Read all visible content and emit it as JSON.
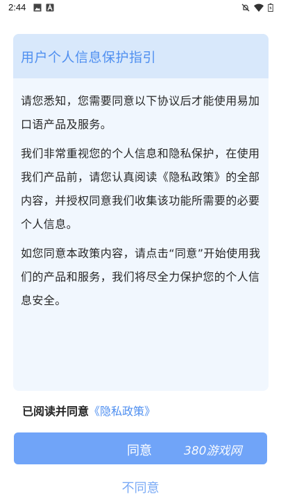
{
  "status_bar": {
    "time": "2:44",
    "icons": [
      "image-icon",
      "app-a-icon",
      "mute-icon",
      "wifi-icon",
      "battery-icon"
    ]
  },
  "dialog": {
    "title": "用户个人信息保护指引",
    "paragraphs": [
      "请您悉知，您需要同意以下协议后才能使用易加口语产品及服务。",
      "我们非常重视您的个人信息和隐私保护，在使用我们产品前，请您认真阅读《隐私政策》的全部内容，并授权同意我们收集该功能所需要的必要个人信息。",
      "如您同意本政策内容，请点击“同意”开始使用我们的产品和服务，我们将尽全力保护您的个人信息安全。"
    ]
  },
  "consent": {
    "prefix": "已阅读并同意",
    "policy_link": "《隐私政策》"
  },
  "buttons": {
    "agree": "同意",
    "disagree": "不同意"
  },
  "watermark": "380游戏网",
  "colors": {
    "accent": "#4f8ff0",
    "button": "#70a4f8",
    "card_bg": "#f1f7fe",
    "header_bg": "#d8e8fb"
  }
}
